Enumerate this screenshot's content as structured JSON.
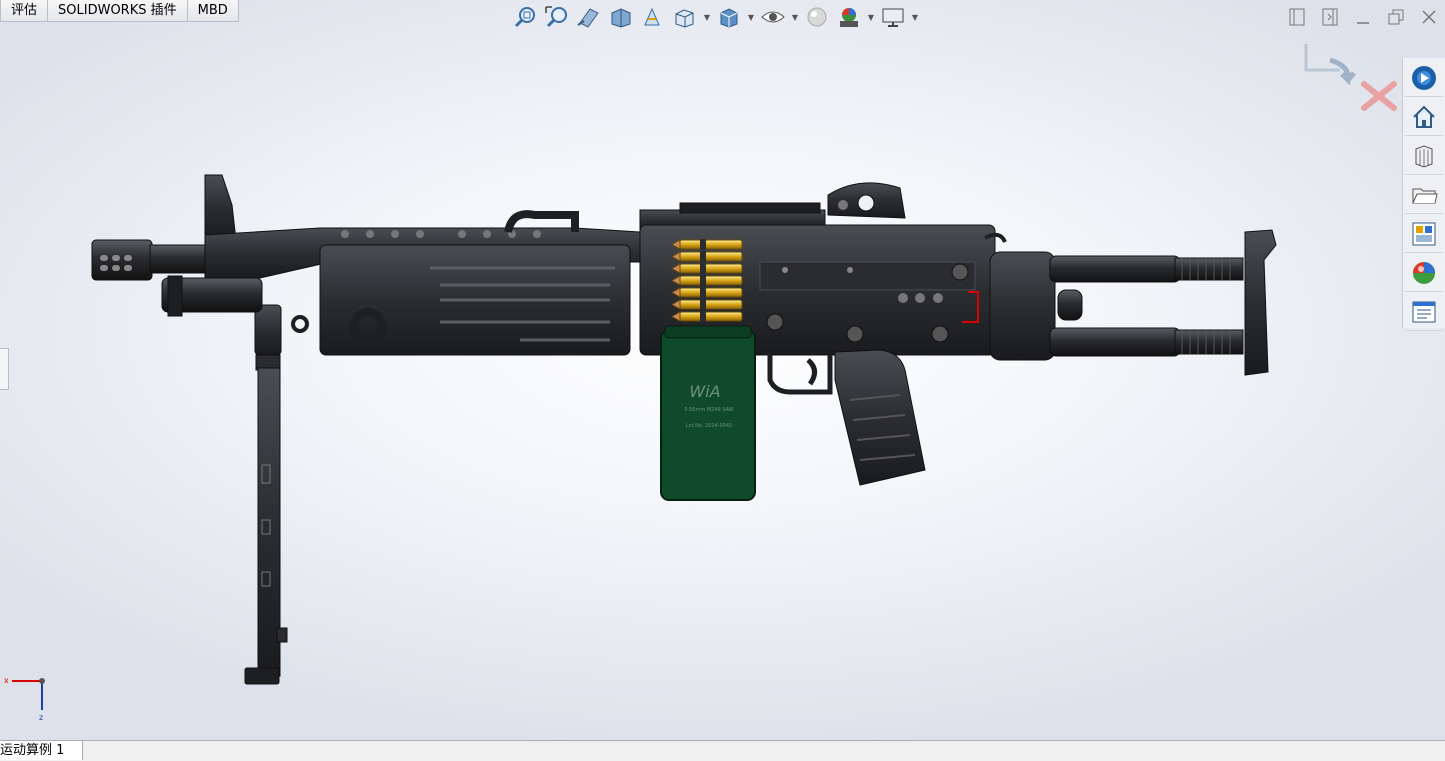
{
  "command_tabs": [
    "评估",
    "SOLIDWORKS 插件",
    "MBD"
  ],
  "hud_toolbar": [
    {
      "icon": "zoom-to-fit-icon",
      "dropdown": false
    },
    {
      "icon": "zoom-to-area-icon",
      "dropdown": false
    },
    {
      "icon": "previous-view-icon",
      "dropdown": false
    },
    {
      "icon": "section-view-icon",
      "dropdown": false
    },
    {
      "icon": "dynamic-annotation-views-icon",
      "dropdown": false
    },
    {
      "icon": "view-orientation-icon",
      "dropdown": true
    },
    {
      "icon": "display-style-icon",
      "dropdown": true
    },
    {
      "icon": "hide-show-items-icon",
      "dropdown": true
    },
    {
      "icon": "edit-appearance-icon",
      "dropdown": false
    },
    {
      "icon": "apply-scene-icon",
      "dropdown": true
    },
    {
      "icon": "view-settings-icon",
      "dropdown": true
    }
  ],
  "task_pane": [
    "solidworks-resources-icon",
    "home-icon",
    "design-library-icon",
    "file-explorer-icon",
    "view-palette-icon",
    "appearances-scenes-icon",
    "custom-properties-icon"
  ],
  "ammo_box": {
    "logo": "WiA",
    "line1": "5.56mm M249 SAW",
    "line2": "Lot No. 2024-0042"
  },
  "triad": {
    "x": "x",
    "z": "z"
  },
  "bottom_tab": "运动算例 1",
  "colors": {
    "receiver": "#2a2c30",
    "ammo_box": "#0f4a2a",
    "cartridge": "#d9a514",
    "background": "#e6eaf0"
  }
}
